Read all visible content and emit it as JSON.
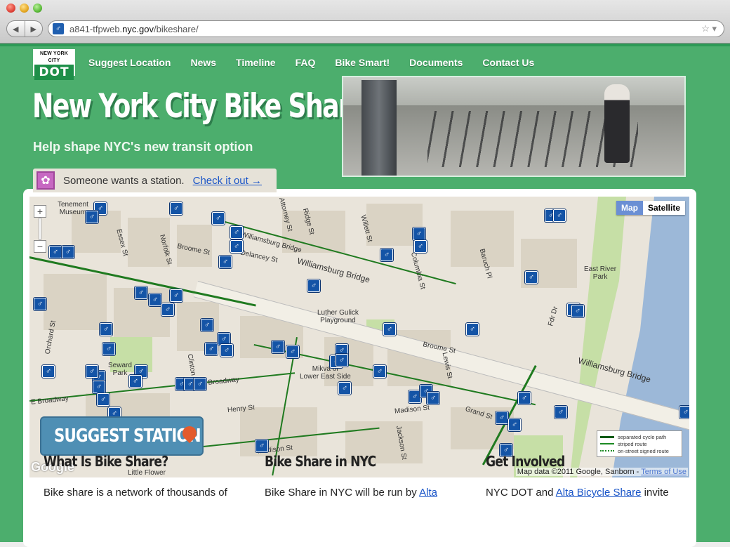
{
  "browser": {
    "url_prefix": "a841-tfpweb.",
    "url_domain": "nyc.gov",
    "url_path": "/bikeshare/"
  },
  "logo": {
    "line1": "NEW YORK CITY",
    "line2": "DOT"
  },
  "nav": [
    "Suggest Location",
    "News",
    "Timeline",
    "FAQ",
    "Bike Smart!",
    "Documents",
    "Contact Us"
  ],
  "hero": {
    "title": "New York City Bike Share",
    "subtitle": "Help shape NYC's new transit option"
  },
  "notice": {
    "message": "Someone wants a station.",
    "link": "Check it out →"
  },
  "map": {
    "type_buttons": [
      "Map",
      "Satellite"
    ],
    "active_type": "Map",
    "zoom_in": "+",
    "zoom_out": "−",
    "legend": [
      "separated cycle path",
      "striped route",
      "on-street signed route"
    ],
    "credit": "Map data ©2011 Google, Sanborn - ",
    "terms": "Terms of Use",
    "google": "Google",
    "suggest_button": "SUGGEST STATION",
    "labels": {
      "tenement": "Tenement\nMuseum",
      "essex": "Essex St",
      "norfolk": "Norfolk St",
      "broome1": "Broome St",
      "broome2": "Broome St",
      "delancey": "Delancey St",
      "williamsburg1": "Williamsburg Bridge",
      "williamsburg2": "Williamsburg Bridge",
      "williamsburg3": "Williamsburg Bridge",
      "attorney": "Attorney St",
      "ridge": "Ridge St",
      "willett": "Willett St",
      "columbia": "Columbia St",
      "baruch": "Baruch Pl",
      "eastriver": "East River\nPark",
      "fdr": "Fdr Dr",
      "luther": "Luther Gulick\nPlayground",
      "orchard": "Orchard St",
      "seward": "Seward\nPark",
      "clinton": "Clinton St",
      "ebroadway": "E Broadway",
      "henry": "Henry St",
      "madison": "Madison St",
      "grand": "Grand St",
      "mikva": "Mikva of\nLower East Side",
      "jackson": "Jackson St",
      "littleflower": "Little Flower",
      "lewis": "Lewis St"
    }
  },
  "columns": [
    {
      "heading": "What Is Bike Share?",
      "text": "Bike share is a network of thousands of",
      "link": ""
    },
    {
      "heading": "Bike Share in NYC",
      "text": "Bike Share in NYC will be run by ",
      "link": "Alta"
    },
    {
      "heading": "Get Involved",
      "text": "NYC DOT and ",
      "link": "Alta Bicycle Share",
      "text_after": " invite"
    }
  ]
}
